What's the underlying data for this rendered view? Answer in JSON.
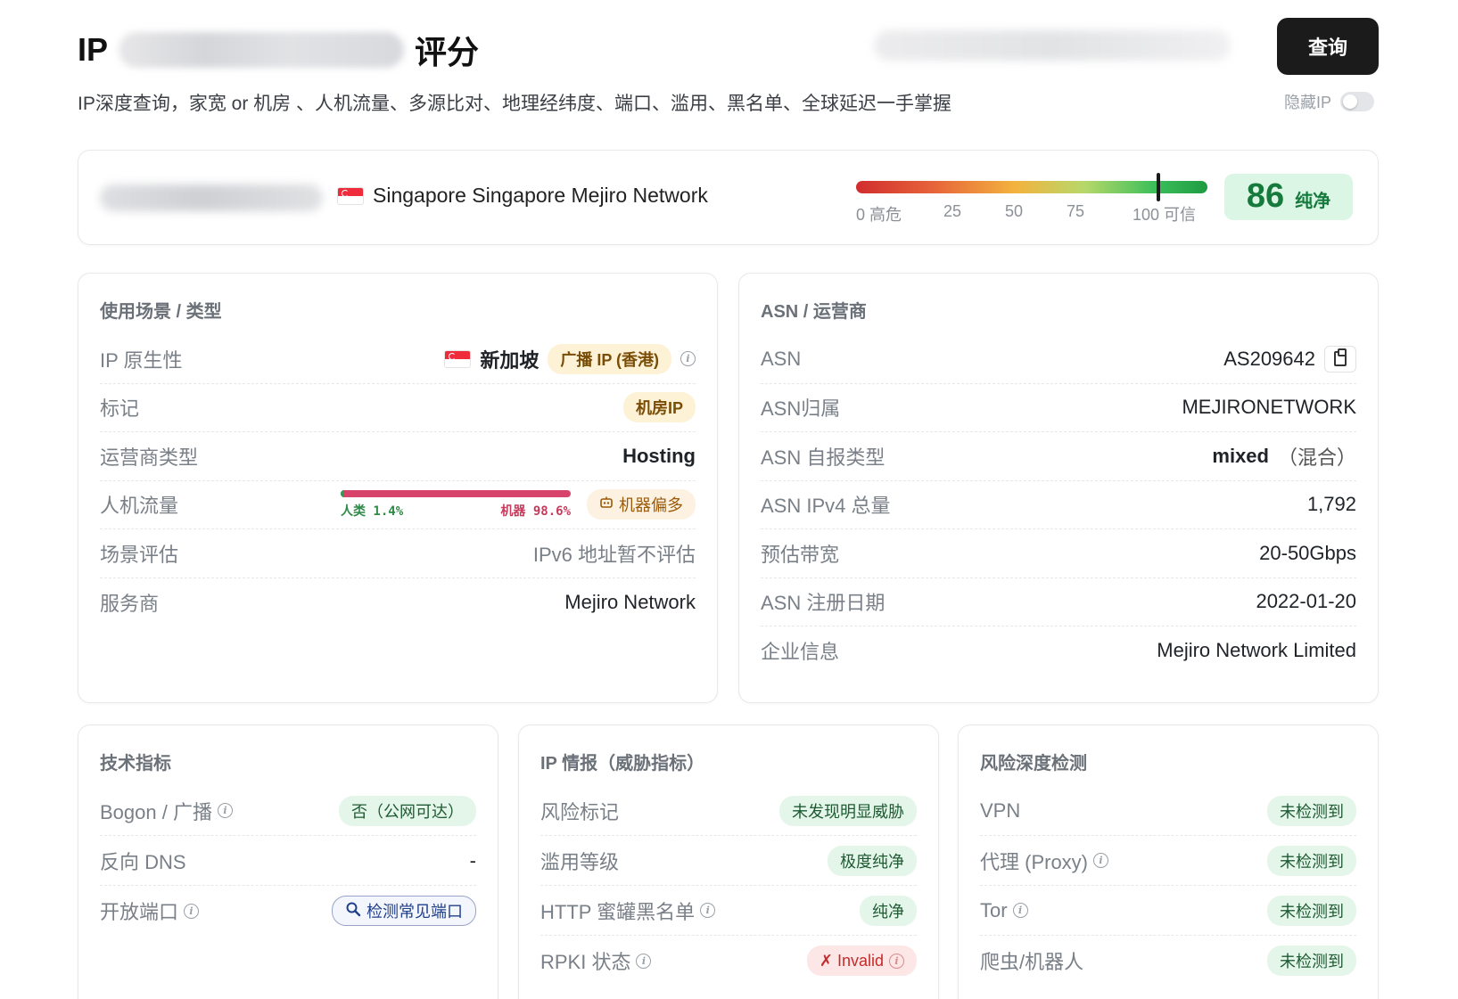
{
  "header": {
    "title_prefix": "IP",
    "title_suffix": "评分",
    "query_button": "查询",
    "subtitle": "IP深度查询，家宽 or 机房 、人机流量、多源比对、地理经纬度、端口、滥用、黑名单、全球延迟一手掌握",
    "hide_ip_label": "隐藏IP",
    "hide_ip_enabled": false
  },
  "summary": {
    "location": "Singapore Singapore Mejiro Network",
    "flag_icon": "singapore-flag-icon",
    "gauge_labels": [
      "0 高危",
      "25",
      "50",
      "75",
      "100 可信"
    ],
    "score": "86",
    "score_label": "纯净",
    "score_value": 86
  },
  "usage": {
    "title": "使用场景 / 类型",
    "native_label": "IP 原生性",
    "native_country": "新加坡",
    "native_badge": "广播 IP (香港)",
    "mark_label": "标记",
    "mark_value": "机房IP",
    "carrier_type_label": "运营商类型",
    "carrier_type_value": "Hosting",
    "traffic_label": "人机流量",
    "traffic_human": "人类 1.4%",
    "traffic_bot": "机器 98.6%",
    "traffic_human_fraction": 0.014,
    "traffic_badge": "机器偏多",
    "scene_label": "场景评估",
    "scene_value": "IPv6 地址暂不评估",
    "provider_label": "服务商",
    "provider_value": "Mejiro Network"
  },
  "asn": {
    "title": "ASN / 运营商",
    "asn_label": "ASN",
    "asn_value": "AS209642",
    "owner_label": "ASN归属",
    "owner_value": "MEJIRONETWORK",
    "selftype_label": "ASN 自报类型",
    "selftype_value": "mixed",
    "selftype_note": "（混合）",
    "ipv4_label": "ASN IPv4 总量",
    "ipv4_value": "1,792",
    "bandwidth_label": "预估带宽",
    "bandwidth_value": "20-50Gbps",
    "regdate_label": "ASN 注册日期",
    "regdate_value": "2022-01-20",
    "company_label": "企业信息",
    "company_value": "Mejiro Network Limited"
  },
  "tech": {
    "title": "技术指标",
    "bogon_label": "Bogon / 广播",
    "bogon_value": "否（公网可达）",
    "rdns_label": "反向 DNS",
    "rdns_value": "-",
    "ports_label": "开放端口",
    "ports_button": "检测常见端口"
  },
  "intel": {
    "title": "IP 情报（威胁指标）",
    "risk_label": "风险标记",
    "risk_value": "未发现明显威胁",
    "abuse_label": "滥用等级",
    "abuse_value": "极度纯净",
    "honeypot_label": "HTTP 蜜罐黑名单",
    "honeypot_value": "纯净",
    "rpki_label": "RPKI 状态",
    "rpki_value": "✗ Invalid"
  },
  "risk": {
    "title": "风险深度检测",
    "vpn_label": "VPN",
    "vpn_value": "未检测到",
    "proxy_label": "代理 (Proxy)",
    "proxy_value": "未检测到",
    "tor_label": "Tor",
    "tor_value": "未检测到",
    "crawler_label": "爬虫/机器人",
    "crawler_value": "未检测到"
  },
  "colors": {
    "accent_dark": "#1b1b1b",
    "score_green": "#157a3c",
    "badge_green_bg": "#e4f6ea",
    "badge_amber_bg": "#fdf1d6",
    "badge_red_bg": "#fde6e6",
    "bot_traffic": "#d8436b",
    "human_traffic": "#2f9b50"
  }
}
